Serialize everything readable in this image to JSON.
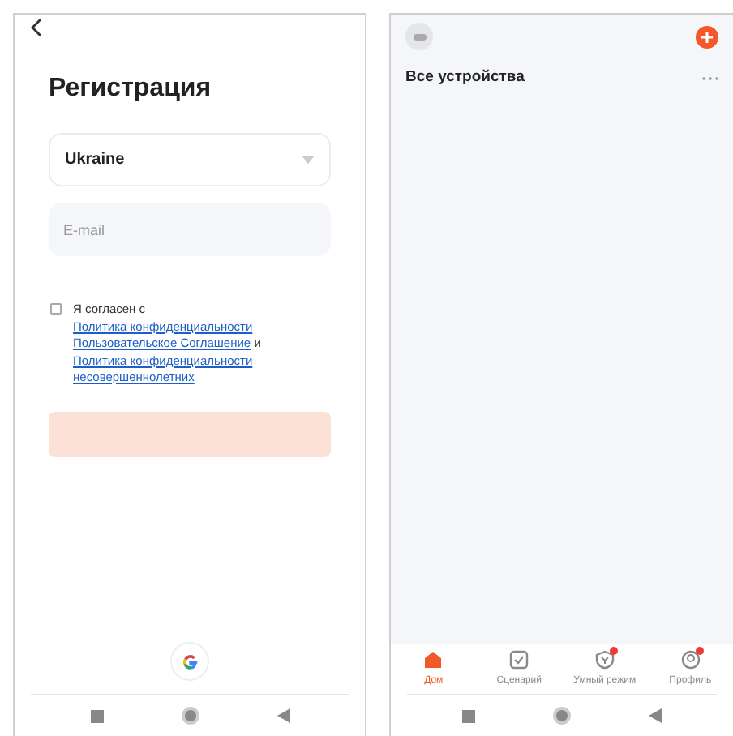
{
  "registration": {
    "title": "Регистрация",
    "country": {
      "value": "Ukraine"
    },
    "email": {
      "placeholder": "E-mail"
    },
    "agreement": {
      "checked": false,
      "parts": [
        {
          "kind": "text",
          "text": "Я согласен с"
        },
        {
          "kind": "link",
          "text": "Политика конфиденциальности"
        },
        {
          "kind": "link",
          "text": "Пользовательское Соглашение"
        },
        {
          "kind": "text",
          "text": " и "
        },
        {
          "kind": "link",
          "text": "Политика конфиденциальности несовершеннолетних"
        }
      ]
    }
  },
  "home": {
    "title": "Все устройства",
    "tabs": [
      {
        "label": "Дом",
        "kind": "home",
        "selected": true,
        "dot": false
      },
      {
        "label": "Сценарий",
        "kind": "scene",
        "selected": false,
        "dot": false
      },
      {
        "label": "Умный режим",
        "kind": "smart",
        "selected": false,
        "dot": true
      },
      {
        "label": "Профиль",
        "kind": "profile",
        "selected": false,
        "dot": true
      }
    ]
  }
}
